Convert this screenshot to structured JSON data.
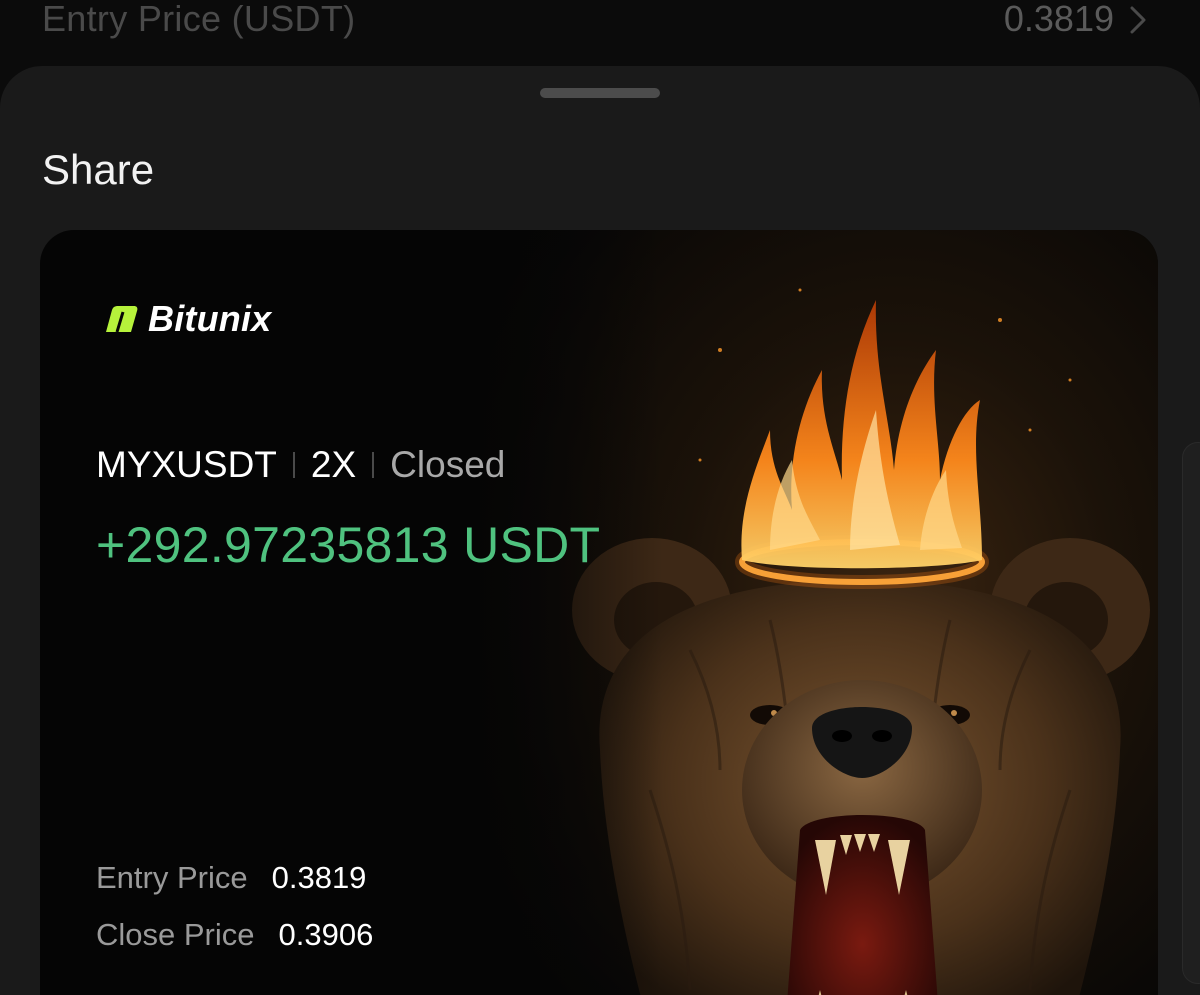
{
  "background_row": {
    "label": "Entry Price (USDT)",
    "value": "0.3819"
  },
  "sheet": {
    "title": "Share"
  },
  "card": {
    "brand": "Bitunix",
    "pair": "MYXUSDT",
    "leverage": "2X",
    "status": "Closed",
    "pnl": "+292.97235813 USDT",
    "entry_label": "Entry Price",
    "entry_value": "0.3819",
    "close_label": "Close Price",
    "close_value": "0.3906",
    "artwork": "bear-with-flaming-crown"
  },
  "colors": {
    "pnl_green": "#4fc27f",
    "brand_lime": "#b6f23b",
    "sheet_bg": "#1a1a1a"
  }
}
